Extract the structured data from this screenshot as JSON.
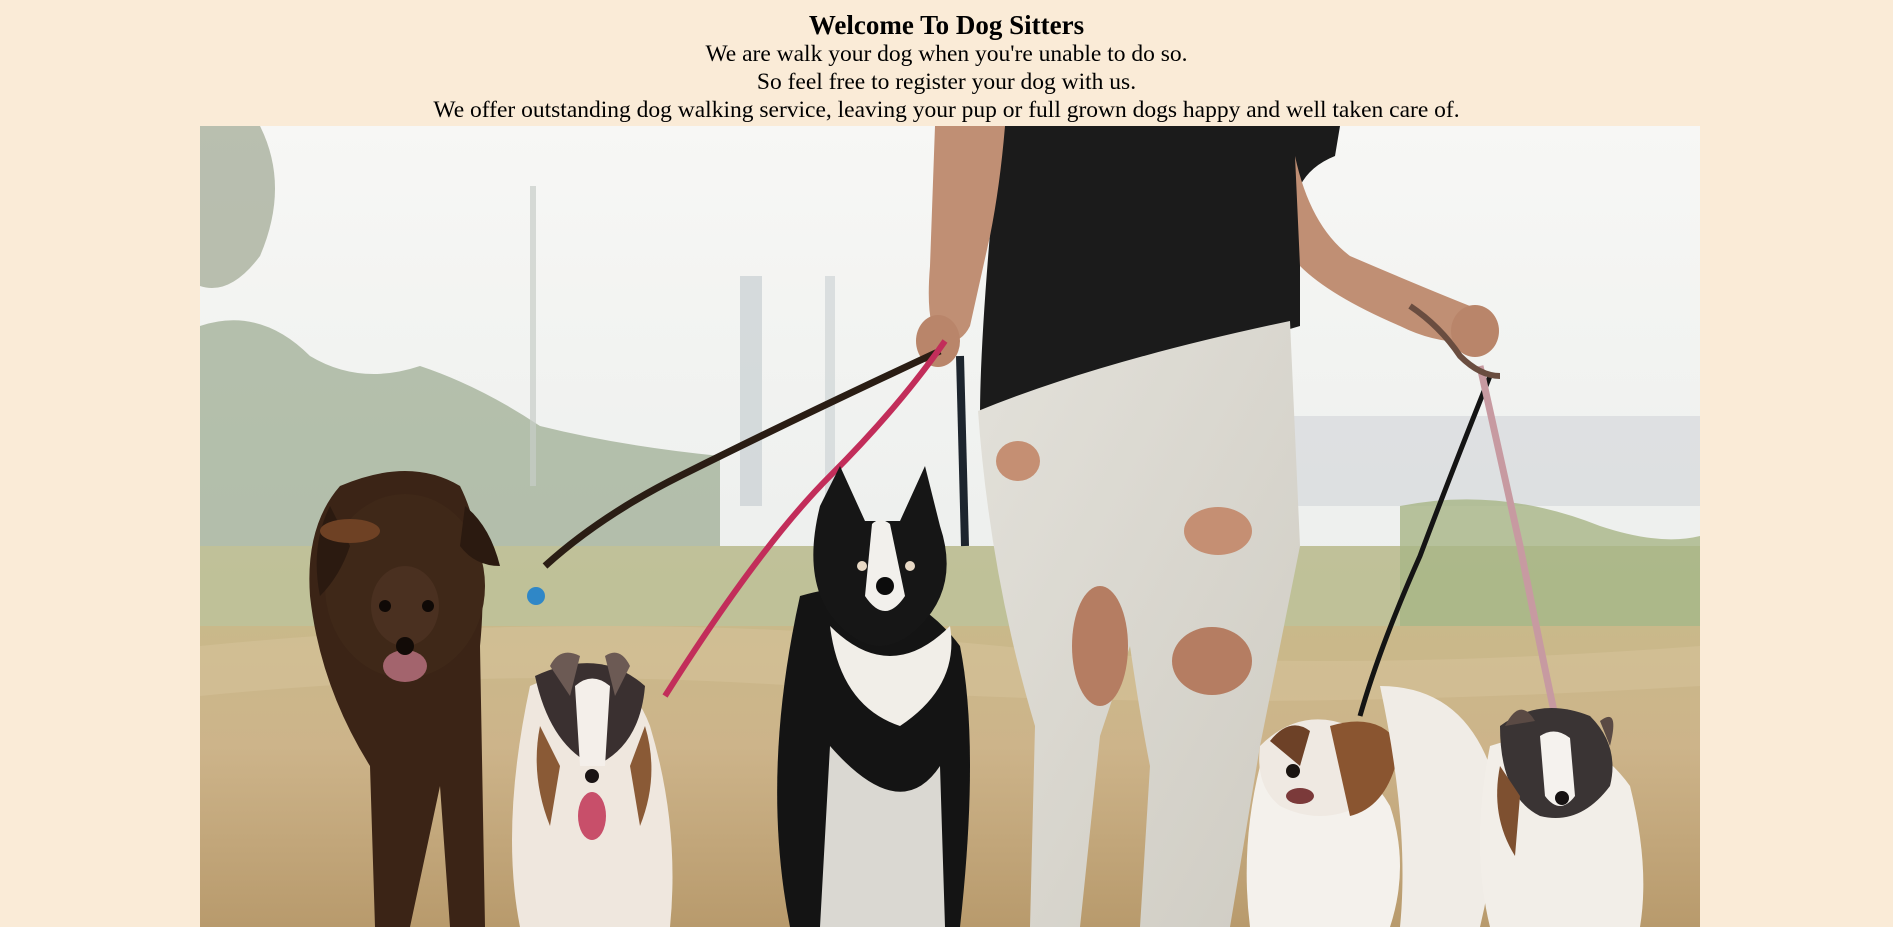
{
  "page": {
    "title": "Welcome To Dog Sitters",
    "lines": [
      "We are walk your dog when you're unable to do so.",
      "So feel free to register your dog with us.",
      "We offer outstanding dog walking service, leaving your pup or full grown dogs happy and well taken care of."
    ]
  },
  "colors": {
    "background": "#FAEBD7",
    "text": "#000000"
  },
  "hero_image": {
    "icon": "dog-walker-photo"
  }
}
